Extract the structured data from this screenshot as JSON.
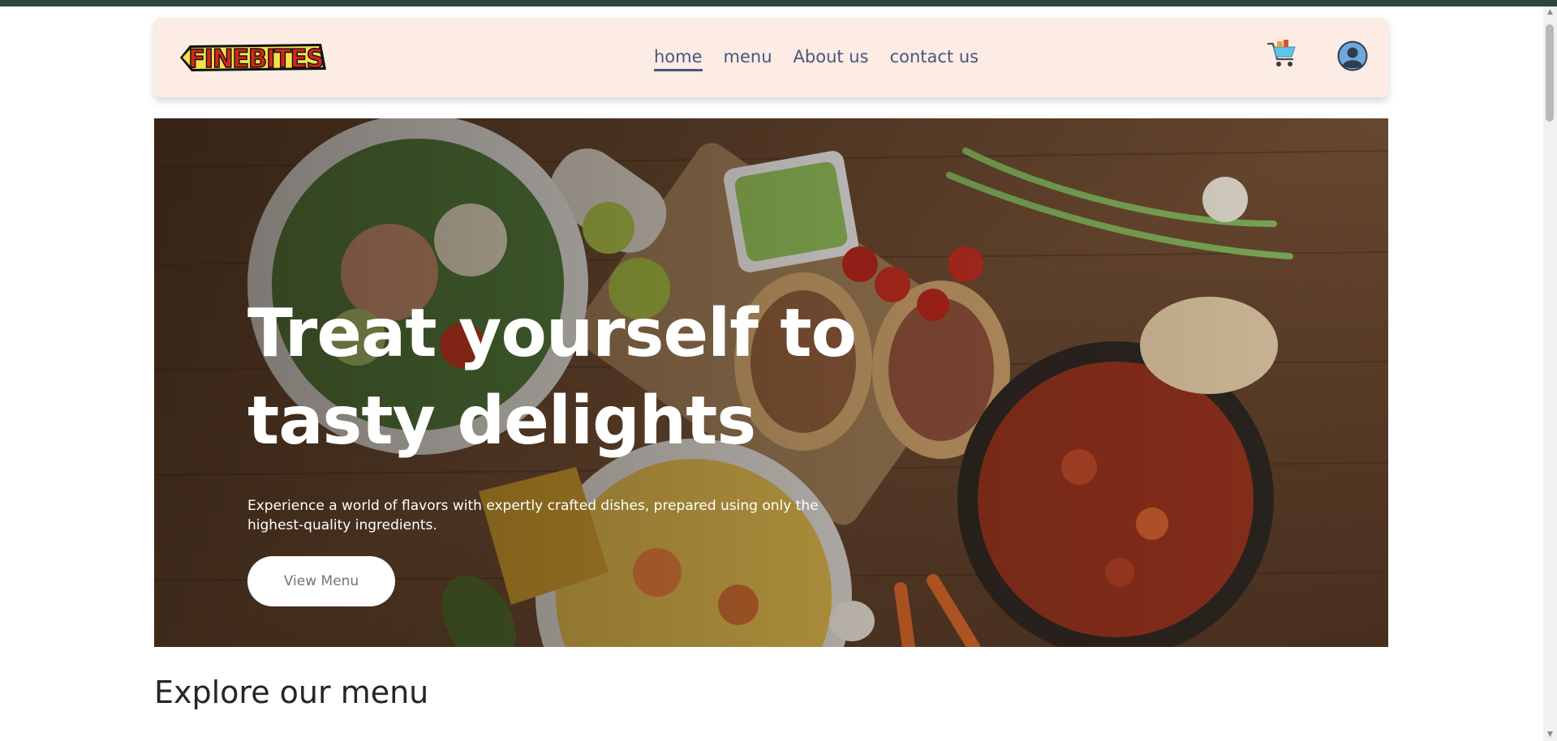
{
  "nav": {
    "logo_text": "FINEBITES",
    "links": [
      "home",
      "menu",
      "About us",
      "contact us"
    ]
  },
  "hero": {
    "title_line1": "Treat yourself to",
    "title_line2": "tasty delights",
    "description": "Experience a world of flavors with expertly crafted dishes, prepared using only the highest-quality ingredients.",
    "button_label": "View Menu"
  },
  "section": {
    "title": "Explore our menu"
  },
  "icons": {
    "cart": "shopping-cart-icon",
    "profile": "user-profile-icon"
  },
  "colors": {
    "top_strip": "#2f4539",
    "navbar_bg": "#fcece4",
    "nav_link": "#49557e",
    "hero_text": "#ffffff"
  }
}
